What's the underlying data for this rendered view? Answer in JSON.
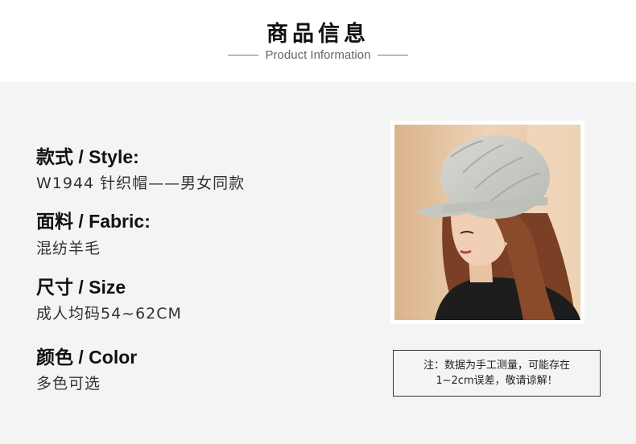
{
  "header": {
    "title": "商品信息",
    "subtitle": "Product Information"
  },
  "fields": [
    {
      "label": "款式 / Style:",
      "value": "W1944 针织帽——男女同款"
    },
    {
      "label": "面料 / Fabric:",
      "value": "混纺羊毛"
    },
    {
      "label": "尺寸 / Size",
      "value": "成人均码54~62CM"
    },
    {
      "label": "颜色 / Color",
      "value": "多色可选"
    }
  ],
  "note": {
    "line1": "注：数据为手工测量，可能存在",
    "line2": "1~2cm误差，敬请谅解！"
  },
  "colors": {
    "header_bg": "#ffffff",
    "content_bg": "#f4f4f4",
    "hat": "#c9cbc6",
    "hair": "#8a4a2c",
    "sweater": "#1c1c1c",
    "photo_bg": "#e8c8a6"
  }
}
